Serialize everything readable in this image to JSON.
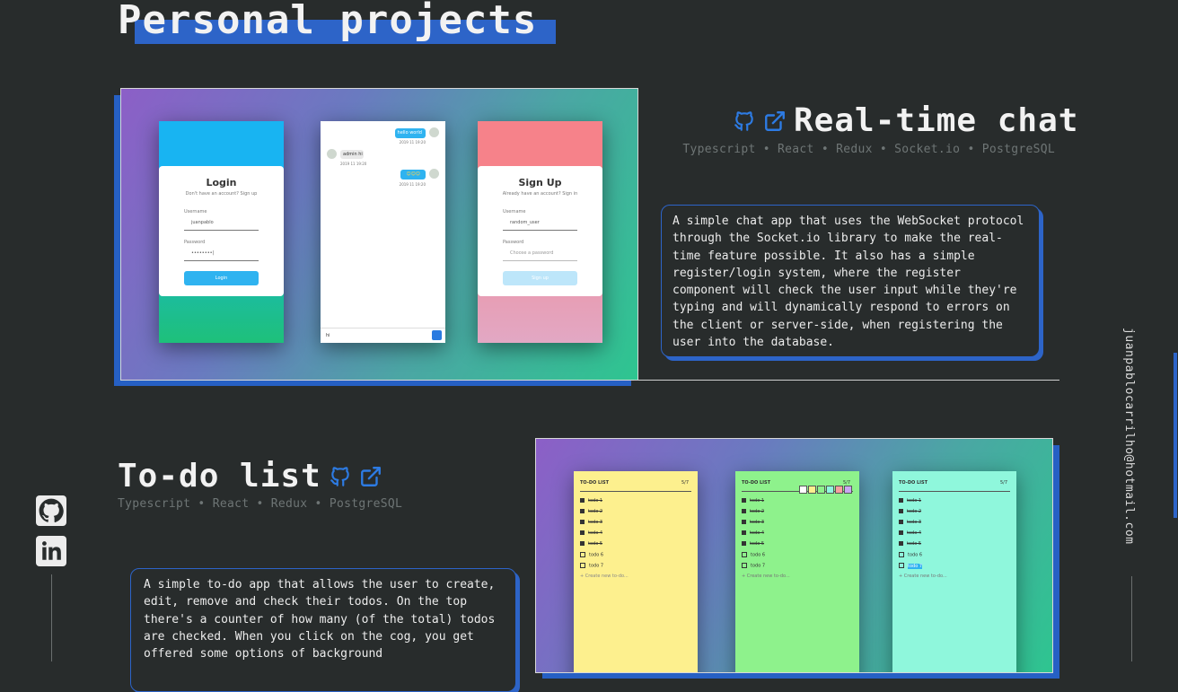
{
  "section": {
    "title": "Personal projects"
  },
  "projects": [
    {
      "title": "Real-time chat",
      "tech": [
        "Typescript",
        "React",
        "Redux",
        "Socket.io",
        "PostgreSQL"
      ],
      "separator": "•",
      "description": "A simple chat app that uses the WebSocket protocol through the Socket.io library to make the real-time feature possible. It also has a simple register/login system, where the register component will check the user input while they're typing and will dynamically respond to errors on the client or server-side, when registering the user into the database.",
      "icons": [
        "github-icon",
        "external-link-icon"
      ],
      "screens": {
        "login": {
          "title": "Login",
          "subtitle": "Don't have an account? Sign up",
          "username_label": "Username",
          "username_value": "juanpablo",
          "password_label": "Password",
          "button": "Login"
        },
        "chat": {
          "msg1": "hello world",
          "msg1_time": "2019 11 19:20",
          "msg2_user": "admin hi",
          "msg2_time": "2019 11 19:20",
          "msg3": "☺☺☺",
          "msg3_time": "2019 11 19:20",
          "input": "hi"
        },
        "signup": {
          "title": "Sign Up",
          "subtitle": "Already have an account? Sign in",
          "username_label": "Username",
          "username_value": "random_user",
          "password_label": "Password",
          "password_placeholder": "Choose a password",
          "button": "Sign up"
        }
      }
    },
    {
      "title": "To-do list",
      "tech": [
        "Typescript",
        "React",
        "Redux",
        "PostgreSQL"
      ],
      "separator": "•",
      "description": "A simple to-do app that allows the user to create, edit, remove and check their todos. On the top there's a counter of how many (of the total) todos are checked. When you click on the cog, you get offered some options of background",
      "icons": [
        "github-icon",
        "external-link-icon"
      ],
      "screens": {
        "header": "TO-DO LIST",
        "count": "5/7",
        "items": [
          "todo 1",
          "todo 2",
          "todo 3",
          "todo 4",
          "todo 5",
          "todo 6",
          "todo 7"
        ],
        "new_item": "Create new to-do..."
      }
    }
  ],
  "social": [
    "github-icon",
    "linkedin-icon"
  ],
  "email": "juanpablocarrilho@hotmail.com",
  "colors": {
    "background": "#282c2c",
    "accent": "#2d64c8",
    "muted": "#6e7575"
  }
}
